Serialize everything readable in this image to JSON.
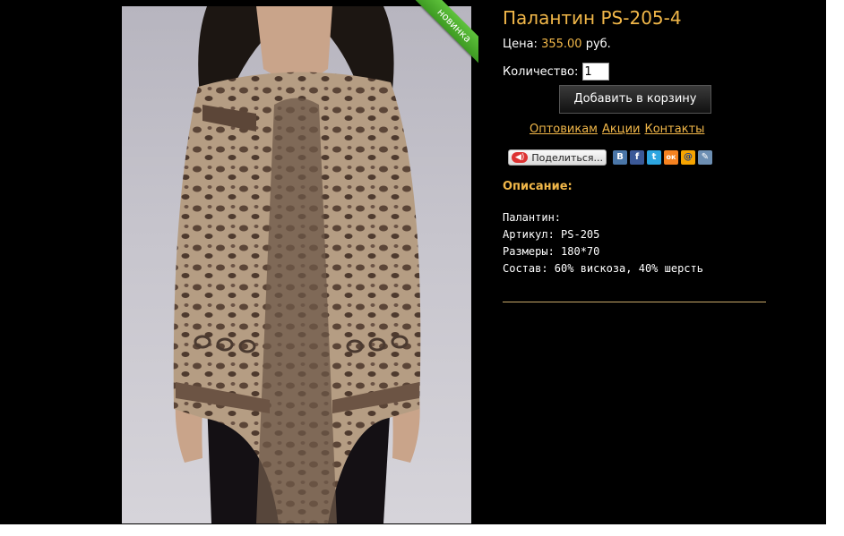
{
  "product": {
    "title": "Палантин PS-205-4",
    "price_label": "Цена:",
    "price_value": "355.00",
    "price_currency": "руб.",
    "quantity_label": "Количество:",
    "quantity_value": "1",
    "add_to_cart": "Добавить в корзину",
    "badge": "новинка"
  },
  "links": [
    "Оптовикам",
    "Акции",
    "Контакты"
  ],
  "share": {
    "label": "Поделиться...",
    "icons": [
      {
        "name": "vkontakte-icon",
        "glyph": "В",
        "color": "#4a76a8"
      },
      {
        "name": "facebook-icon",
        "glyph": "f",
        "color": "#3b5998"
      },
      {
        "name": "twitter-icon",
        "glyph": "t",
        "color": "#2ca5e0"
      },
      {
        "name": "odnoklassniki-icon",
        "glyph": "ок",
        "color": "#f58220"
      },
      {
        "name": "mailru-icon",
        "glyph": "@",
        "color": "#f6a400"
      },
      {
        "name": "livejournal-icon",
        "glyph": "✎",
        "color": "#6d8fb3"
      }
    ]
  },
  "description": {
    "heading": "Описание:",
    "lines": [
      "Палантин:",
      "Артикул: PS-205",
      "Размеры: 180*70",
      "Состав: 60% вискоза, 40% шерсть"
    ]
  },
  "colors": {
    "accent": "#f1b749",
    "background": "#000000",
    "badge": "#4caf2a"
  }
}
